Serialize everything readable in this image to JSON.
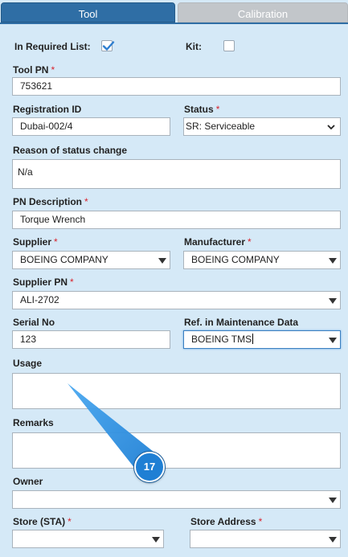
{
  "tabs": [
    {
      "label": "Tool",
      "active": true
    },
    {
      "label": "Calibration",
      "active": false
    }
  ],
  "form": {
    "in_required_list": {
      "label": "In Required List:",
      "checked": true
    },
    "kit": {
      "label": "Kit:",
      "checked": false
    },
    "tool_pn": {
      "label": "Tool PN",
      "required": "*",
      "value": "753621"
    },
    "registration_id": {
      "label": "Registration ID",
      "value": "Dubai-002/4"
    },
    "status": {
      "label": "Status",
      "required": "*",
      "value": "SR: Serviceable"
    },
    "reason_status_change": {
      "label": "Reason of status change",
      "value": "N/a"
    },
    "pn_description": {
      "label": "PN Description",
      "required": "*",
      "value": "Torque Wrench"
    },
    "supplier": {
      "label": "Supplier",
      "required": "*",
      "value": "BOEING COMPANY"
    },
    "manufacturer": {
      "label": "Manufacturer",
      "required": "*",
      "value": "BOEING COMPANY"
    },
    "supplier_pn": {
      "label": "Supplier PN",
      "required": "*",
      "value": "ALI-2702"
    },
    "serial_no": {
      "label": "Serial No",
      "value": "123"
    },
    "ref_maintenance_data": {
      "label": "Ref. in Maintenance Data",
      "value": "BOEING TMS"
    },
    "usage": {
      "label": "Usage",
      "value": ""
    },
    "remarks": {
      "label": "Remarks",
      "value": ""
    },
    "owner": {
      "label": "Owner",
      "value": ""
    },
    "store_sta": {
      "label": "Store (STA)",
      "required": "*",
      "value": ""
    },
    "store_address": {
      "label": "Store Address",
      "required": "*",
      "value": ""
    }
  },
  "callout": {
    "number": "17",
    "color": "#1f7fd4"
  }
}
